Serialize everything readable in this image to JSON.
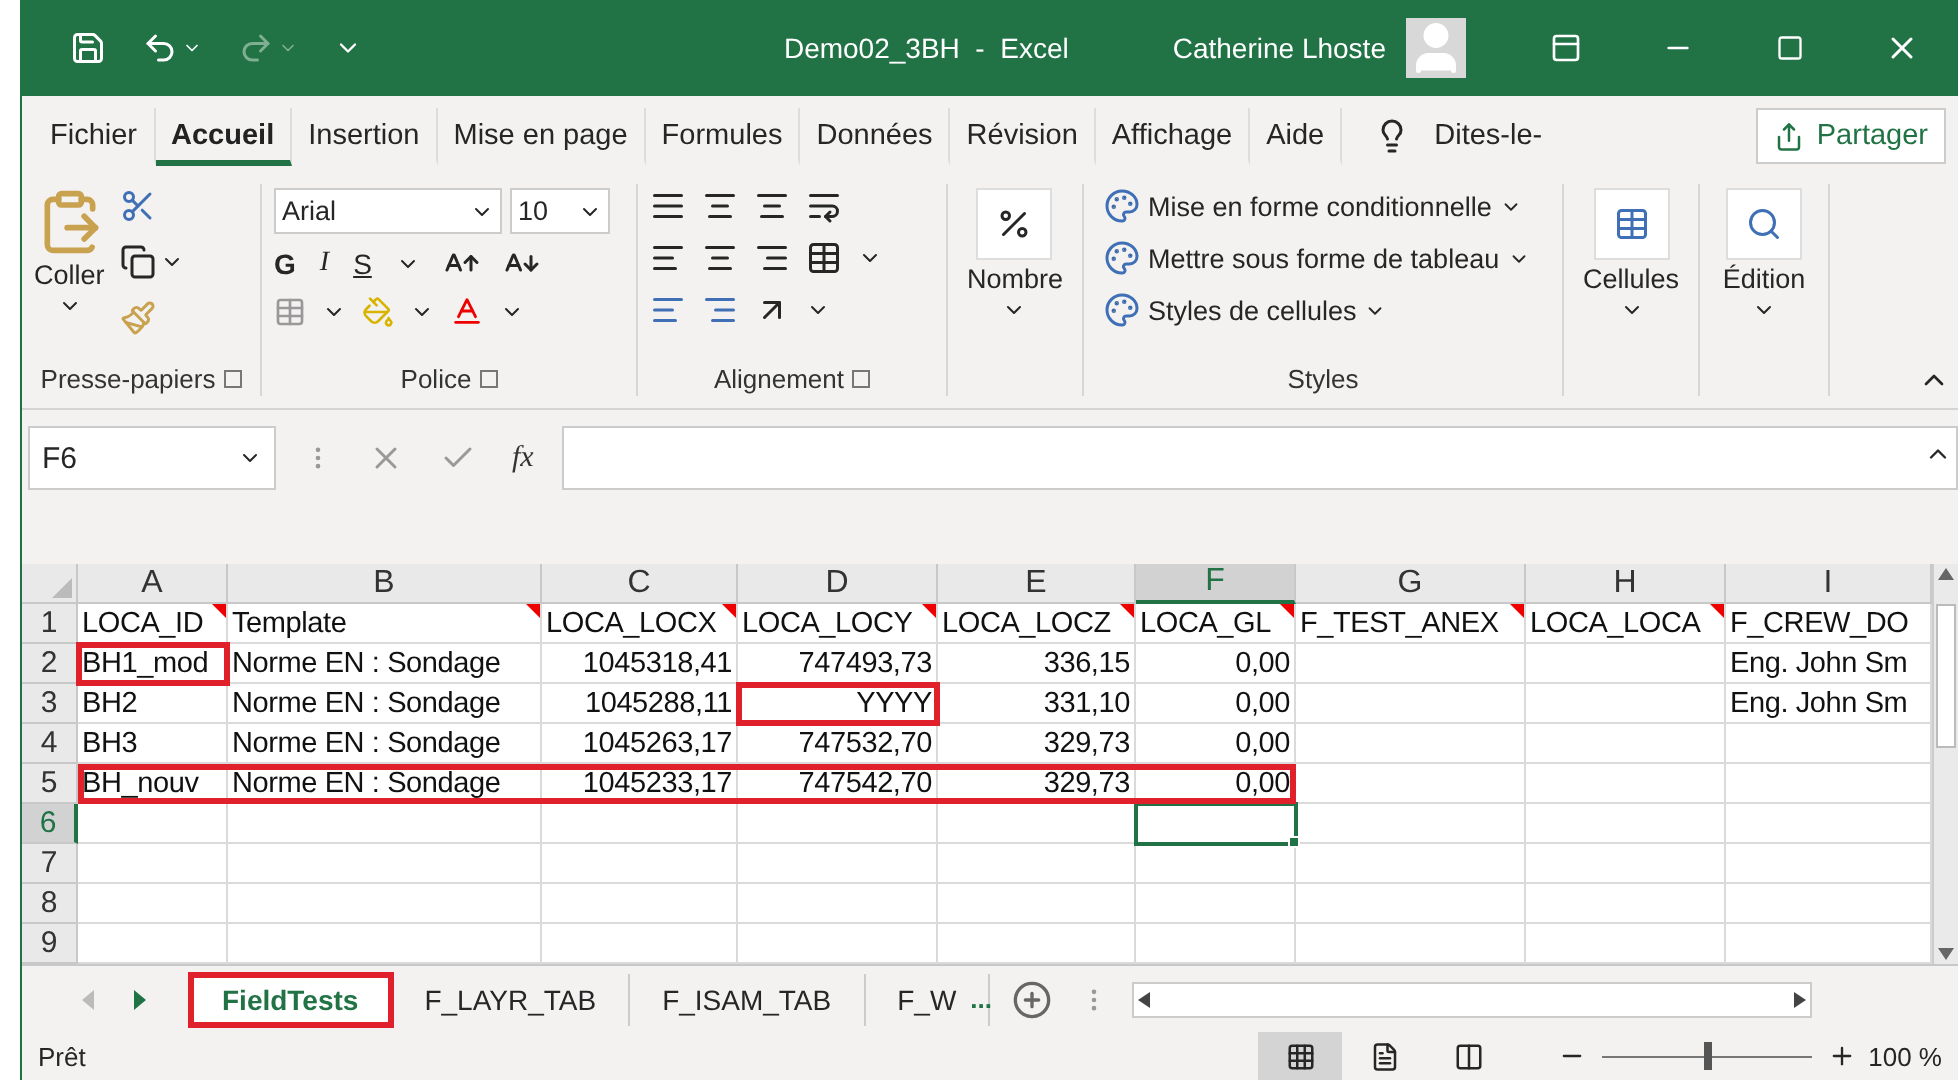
{
  "title_bar": {
    "quick_access": [
      {
        "kind": "save",
        "disabled": false
      },
      {
        "kind": "undo",
        "disabled": false
      },
      {
        "kind": "redo",
        "disabled": true
      },
      {
        "kind": "customize",
        "disabled": false
      }
    ],
    "title": "Demo02_3BH  -  Excel",
    "user": "Catherine Lhoste"
  },
  "menu_tabs": [
    {
      "label": "Fichier",
      "selected": false
    },
    {
      "label": "Accueil",
      "selected": true
    },
    {
      "label": "Insertion",
      "selected": false
    },
    {
      "label": "Mise en page",
      "selected": false
    },
    {
      "label": "Formules",
      "selected": false
    },
    {
      "label": "Données",
      "selected": false
    },
    {
      "label": "Révision",
      "selected": false
    },
    {
      "label": "Affichage",
      "selected": false
    },
    {
      "label": "Aide",
      "selected": false
    }
  ],
  "tell_me": "Dites-le-",
  "share_button": "Partager",
  "ribbon": {
    "clipboard": {
      "paste": "Coller",
      "label": "Presse-papiers"
    },
    "font": {
      "font_name": "Arial",
      "font_size": "10",
      "bold": "G",
      "italic": "I",
      "underline": "S",
      "label": "Police"
    },
    "alignment": {
      "label": "Alignement"
    },
    "number": {
      "button": "Nombre"
    },
    "styles": {
      "items": [
        "Mise en forme conditionnelle",
        "Mettre sous forme de tableau",
        "Styles de cellules"
      ],
      "label": "Styles"
    },
    "cells": {
      "button": "Cellules"
    },
    "editing": {
      "button": "Édition"
    }
  },
  "formula_bar": {
    "name_box": "F6",
    "function_label": "fx"
  },
  "sheet": {
    "columns": [
      {
        "letter": "A",
        "kind": "text",
        "selected": false
      },
      {
        "letter": "B",
        "kind": "text",
        "selected": false
      },
      {
        "letter": "C",
        "kind": "number",
        "selected": false
      },
      {
        "letter": "D",
        "kind": "number",
        "selected": false
      },
      {
        "letter": "E",
        "kind": "number",
        "selected": false
      },
      {
        "letter": "F",
        "kind": "number",
        "selected": true
      },
      {
        "letter": "G",
        "selected": false
      },
      {
        "letter": "H",
        "selected": false
      },
      {
        "letter": "I",
        "kind": "text",
        "selected": false
      }
    ],
    "rows": [
      {
        "number": "1",
        "selected": false,
        "outlined": false,
        "cells": {
          "A": {
            "text": "LOCA_ID",
            "comment": true,
            "outlined": false
          },
          "B": {
            "text": "Template",
            "comment": true,
            "outlined": false
          },
          "C": {
            "text": "LOCA_LOCX",
            "comment": true,
            "outlined": false
          },
          "D": {
            "text": "LOCA_LOCY",
            "comment": true,
            "outlined": false
          },
          "E": {
            "text": "LOCA_LOCZ",
            "comment": true,
            "outlined": false
          },
          "F": {
            "text": "LOCA_GL",
            "comment": true,
            "outlined": false
          },
          "G": {
            "text": "F_TEST_ANEX",
            "comment": true,
            "outlined": false
          },
          "H": {
            "text": "LOCA_LOCA",
            "comment": true,
            "outlined": false
          },
          "I": {
            "text": "F_CREW_DO",
            "comment": false,
            "outlined": false
          }
        }
      },
      {
        "number": "2",
        "selected": false,
        "outlined": false,
        "cells": {
          "A": {
            "text": "BH1_mod",
            "comment": false,
            "outlined": true
          },
          "B": {
            "text": "Norme EN : Sondage",
            "comment": false,
            "outlined": false
          },
          "C": {
            "text": "1045318,41",
            "comment": false,
            "outlined": false
          },
          "D": {
            "text": "747493,73",
            "comment": false,
            "outlined": false
          },
          "E": {
            "text": "336,15",
            "comment": false,
            "outlined": false
          },
          "F": {
            "text": "0,00",
            "comment": false,
            "outlined": false
          },
          "I": {
            "text": "Eng. John Sm",
            "comment": false,
            "outlined": false
          }
        }
      },
      {
        "number": "3",
        "selected": false,
        "outlined": false,
        "cells": {
          "A": {
            "text": "BH2",
            "comment": false,
            "outlined": false
          },
          "B": {
            "text": "Norme EN : Sondage",
            "comment": false,
            "outlined": false
          },
          "C": {
            "text": "1045288,11",
            "comment": false,
            "outlined": false
          },
          "D": {
            "text": "YYYY",
            "comment": false,
            "outlined": true
          },
          "E": {
            "text": "331,10",
            "comment": false,
            "outlined": false
          },
          "F": {
            "text": "0,00",
            "comment": false,
            "outlined": false
          },
          "I": {
            "text": "Eng. John Sm",
            "comment": false,
            "outlined": false
          }
        }
      },
      {
        "number": "4",
        "selected": false,
        "outlined": false,
        "cells": {
          "A": {
            "text": "BH3",
            "comment": false,
            "outlined": false
          },
          "B": {
            "text": "Norme EN : Sondage",
            "comment": false,
            "outlined": false
          },
          "C": {
            "text": "1045263,17",
            "comment": false,
            "outlined": false
          },
          "D": {
            "text": "747532,70",
            "comment": false,
            "outlined": false
          },
          "E": {
            "text": "329,73",
            "comment": false,
            "outlined": false
          },
          "F": {
            "text": "0,00",
            "comment": false,
            "outlined": false
          }
        }
      },
      {
        "number": "5",
        "selected": false,
        "outlined": true,
        "cells": {
          "A": {
            "text": "BH_nouv",
            "comment": false,
            "outlined": false
          },
          "B": {
            "text": "Norme EN : Sondage",
            "comment": false,
            "outlined": false
          },
          "C": {
            "text": "1045233,17",
            "comment": false,
            "outlined": false
          },
          "D": {
            "text": "747542,70",
            "comment": false,
            "outlined": false
          },
          "E": {
            "text": "329,73",
            "comment": false,
            "outlined": false
          },
          "F": {
            "text": "0,00",
            "comment": false,
            "outlined": false
          }
        }
      },
      {
        "number": "6",
        "selected": true,
        "outlined": false
      },
      {
        "number": "7",
        "selected": false,
        "outlined": false
      },
      {
        "number": "8",
        "selected": false,
        "outlined": false
      },
      {
        "number": "9",
        "selected": false,
        "outlined": false
      }
    ]
  },
  "sheet_tabs": [
    {
      "label": "FieldTests",
      "selected": true,
      "outlined": true
    },
    {
      "label": "F_LAYR_TAB",
      "selected": false,
      "outlined": false
    },
    {
      "label": "F_ISAM_TAB",
      "selected": false,
      "outlined": false
    },
    {
      "label": "F_W",
      "selected": false,
      "outlined": false
    }
  ],
  "more_tabs": "...",
  "status_bar": {
    "status": "Prêt",
    "views": [
      {
        "kind": "normal",
        "selected": true
      },
      {
        "kind": "page_layout",
        "selected": false
      },
      {
        "kind": "page_break",
        "selected": false
      }
    ],
    "zoom": {
      "level": 0.5,
      "reading": "100 %"
    }
  }
}
